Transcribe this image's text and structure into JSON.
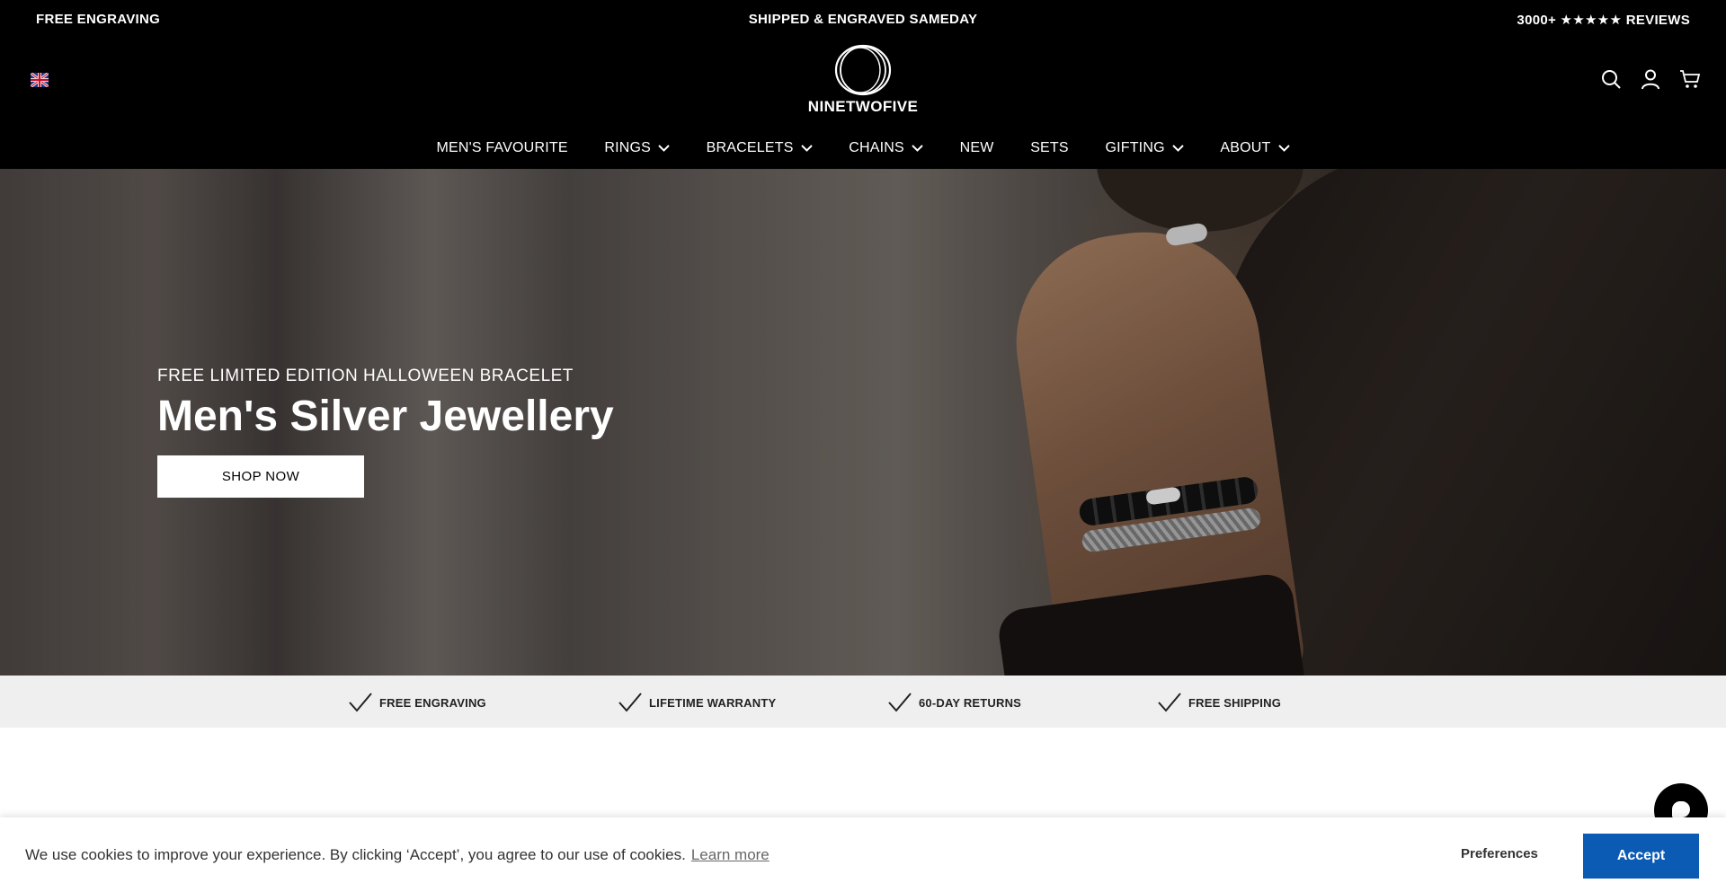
{
  "announcement": {
    "left": "FREE ENGRAVING",
    "center": "SHIPPED & ENGRAVED SAMEDAY",
    "right": "3000+ ★★★★★ REVIEWS"
  },
  "header": {
    "logo_text": "NINETWOFIVE",
    "icons": [
      "uk-flag-icon",
      "search-icon",
      "account-icon",
      "cart-icon"
    ]
  },
  "nav": {
    "items": [
      {
        "label": "MEN'S FAVOURITE",
        "dropdown": false
      },
      {
        "label": "RINGS",
        "dropdown": true
      },
      {
        "label": "BRACELETS",
        "dropdown": true
      },
      {
        "label": "CHAINS",
        "dropdown": true
      },
      {
        "label": "NEW",
        "dropdown": false
      },
      {
        "label": "SETS",
        "dropdown": false
      },
      {
        "label": "GIFTING",
        "dropdown": true
      },
      {
        "label": "ABOUT",
        "dropdown": true
      }
    ]
  },
  "hero": {
    "kicker": "FREE LIMITED EDITION HALLOWEEN BRACELET",
    "title": "Men's Silver Jewellery",
    "cta": "SHOP NOW"
  },
  "features": [
    "FREE ENGRAVING",
    "LIFETIME WARRANTY",
    "60-DAY RETURNS",
    "FREE SHIPPING"
  ],
  "cookie": {
    "text": "We use cookies to improve your experience. By clicking ‘Accept’, you agree to our use of cookies.",
    "link": "Learn more",
    "preferences": "Preferences",
    "accept": "Accept"
  },
  "colors": {
    "header_bg": "#000000",
    "features_bg": "#efefef",
    "accept_btn": "#0b5bb5"
  }
}
